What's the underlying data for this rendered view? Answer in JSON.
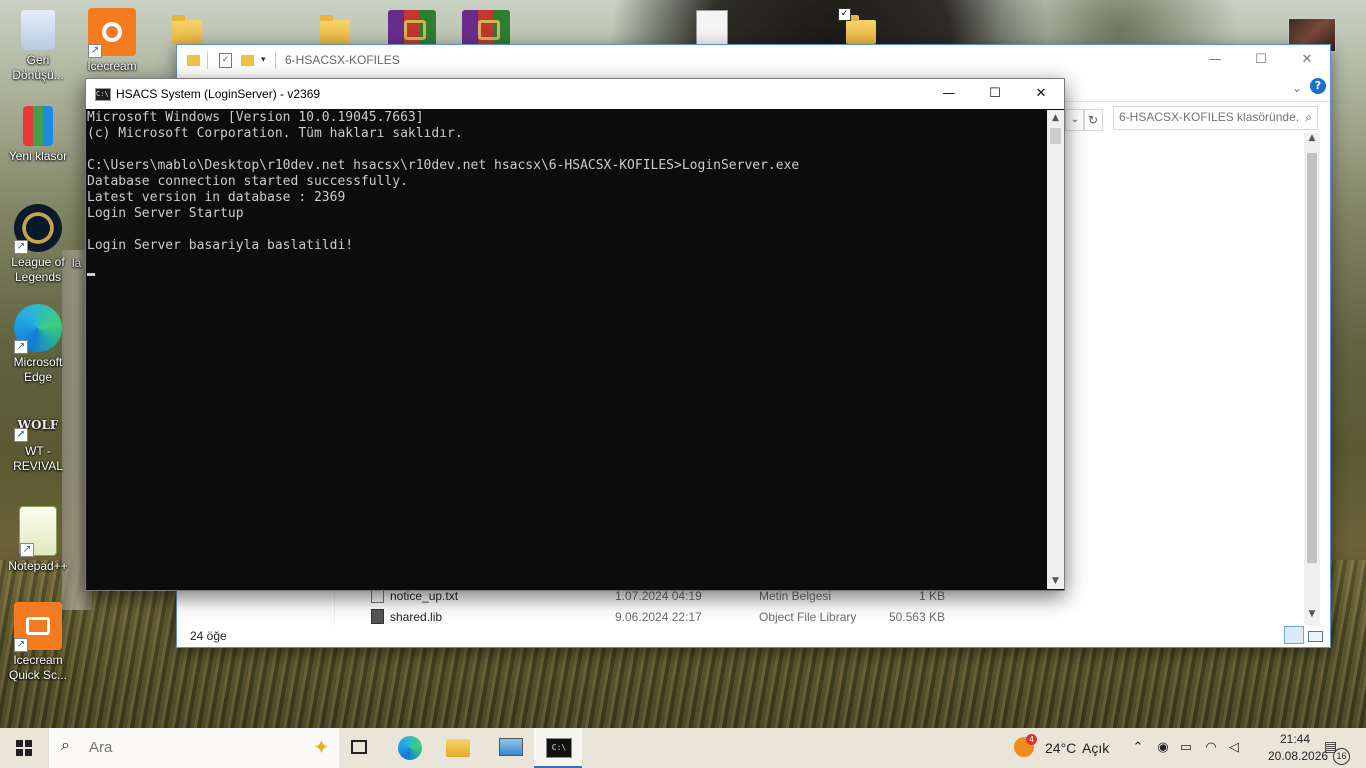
{
  "desktop": {
    "icons": [
      {
        "label": "Geri Dönüşü...",
        "icon": "recycle-bin-icon"
      },
      {
        "label": "Icecream Screen R...",
        "icon": "icecream-recorder-icon"
      },
      {
        "label": "Yeni klasör",
        "icon": "folder-icon"
      },
      {
        "label": "League of Legends",
        "icon": "league-of-legends-icon"
      },
      {
        "label": "Microsoft Edge",
        "icon": "edge-icon"
      },
      {
        "label": "WT - REVIVAL",
        "icon": "wolfteam-icon"
      },
      {
        "label": "Notepad++",
        "icon": "notepadpp-icon"
      },
      {
        "label": "Icecream Quick Sc...",
        "icon": "icecream-screenshot-icon"
      },
      {
        "label": "la",
        "icon": "partial-icon"
      }
    ]
  },
  "explorer": {
    "title": "6-HSACSX-KOFILES",
    "search_placeholder": "6-HSACSX-KOFILES klasöründe...",
    "status": "24 öğe",
    "files": [
      {
        "name": "notice_up.txt",
        "date": "1.07.2024 04:19",
        "type": "Metin Belgesi",
        "size": "1 KB"
      },
      {
        "name": "shared.lib",
        "date": "9.06.2024 22:17",
        "type": "Object File Library",
        "size": "50.563 KB"
      }
    ],
    "help": "?"
  },
  "console": {
    "title": "HSACS System (LoginServer) - v2369",
    "lines": [
      "Microsoft Windows [Version 10.0.19045.7663]",
      "(c) Microsoft Corporation. Tüm hakları saklıdır.",
      "",
      "C:\\Users\\mablo\\Desktop\\r10dev.net hsacsx\\r10dev.net hsacsx\\6-HSACSX-KOFILES>LoginServer.exe",
      "Database connection started successfully.",
      "Latest version in database : 2369",
      "Login Server Startup",
      "",
      "Login Server basariyla baslatildi!",
      ""
    ],
    "colors": {
      "background": "#0c0c0c",
      "text": "#cccccc"
    }
  },
  "taskbar": {
    "search_placeholder": "Ara",
    "weather": {
      "temp": "24°C",
      "condition": "Açık",
      "badge": "4"
    },
    "clock": {
      "time": "21:44",
      "date": "20.08.2026"
    },
    "notification_count": "16",
    "apps": [
      "task-view-icon",
      "edge-icon",
      "file-explorer-icon",
      "remote-desktop-icon",
      "command-prompt-icon"
    ]
  },
  "window_controls": {
    "minimize": "—",
    "maximize": "☐",
    "close": "✕"
  }
}
